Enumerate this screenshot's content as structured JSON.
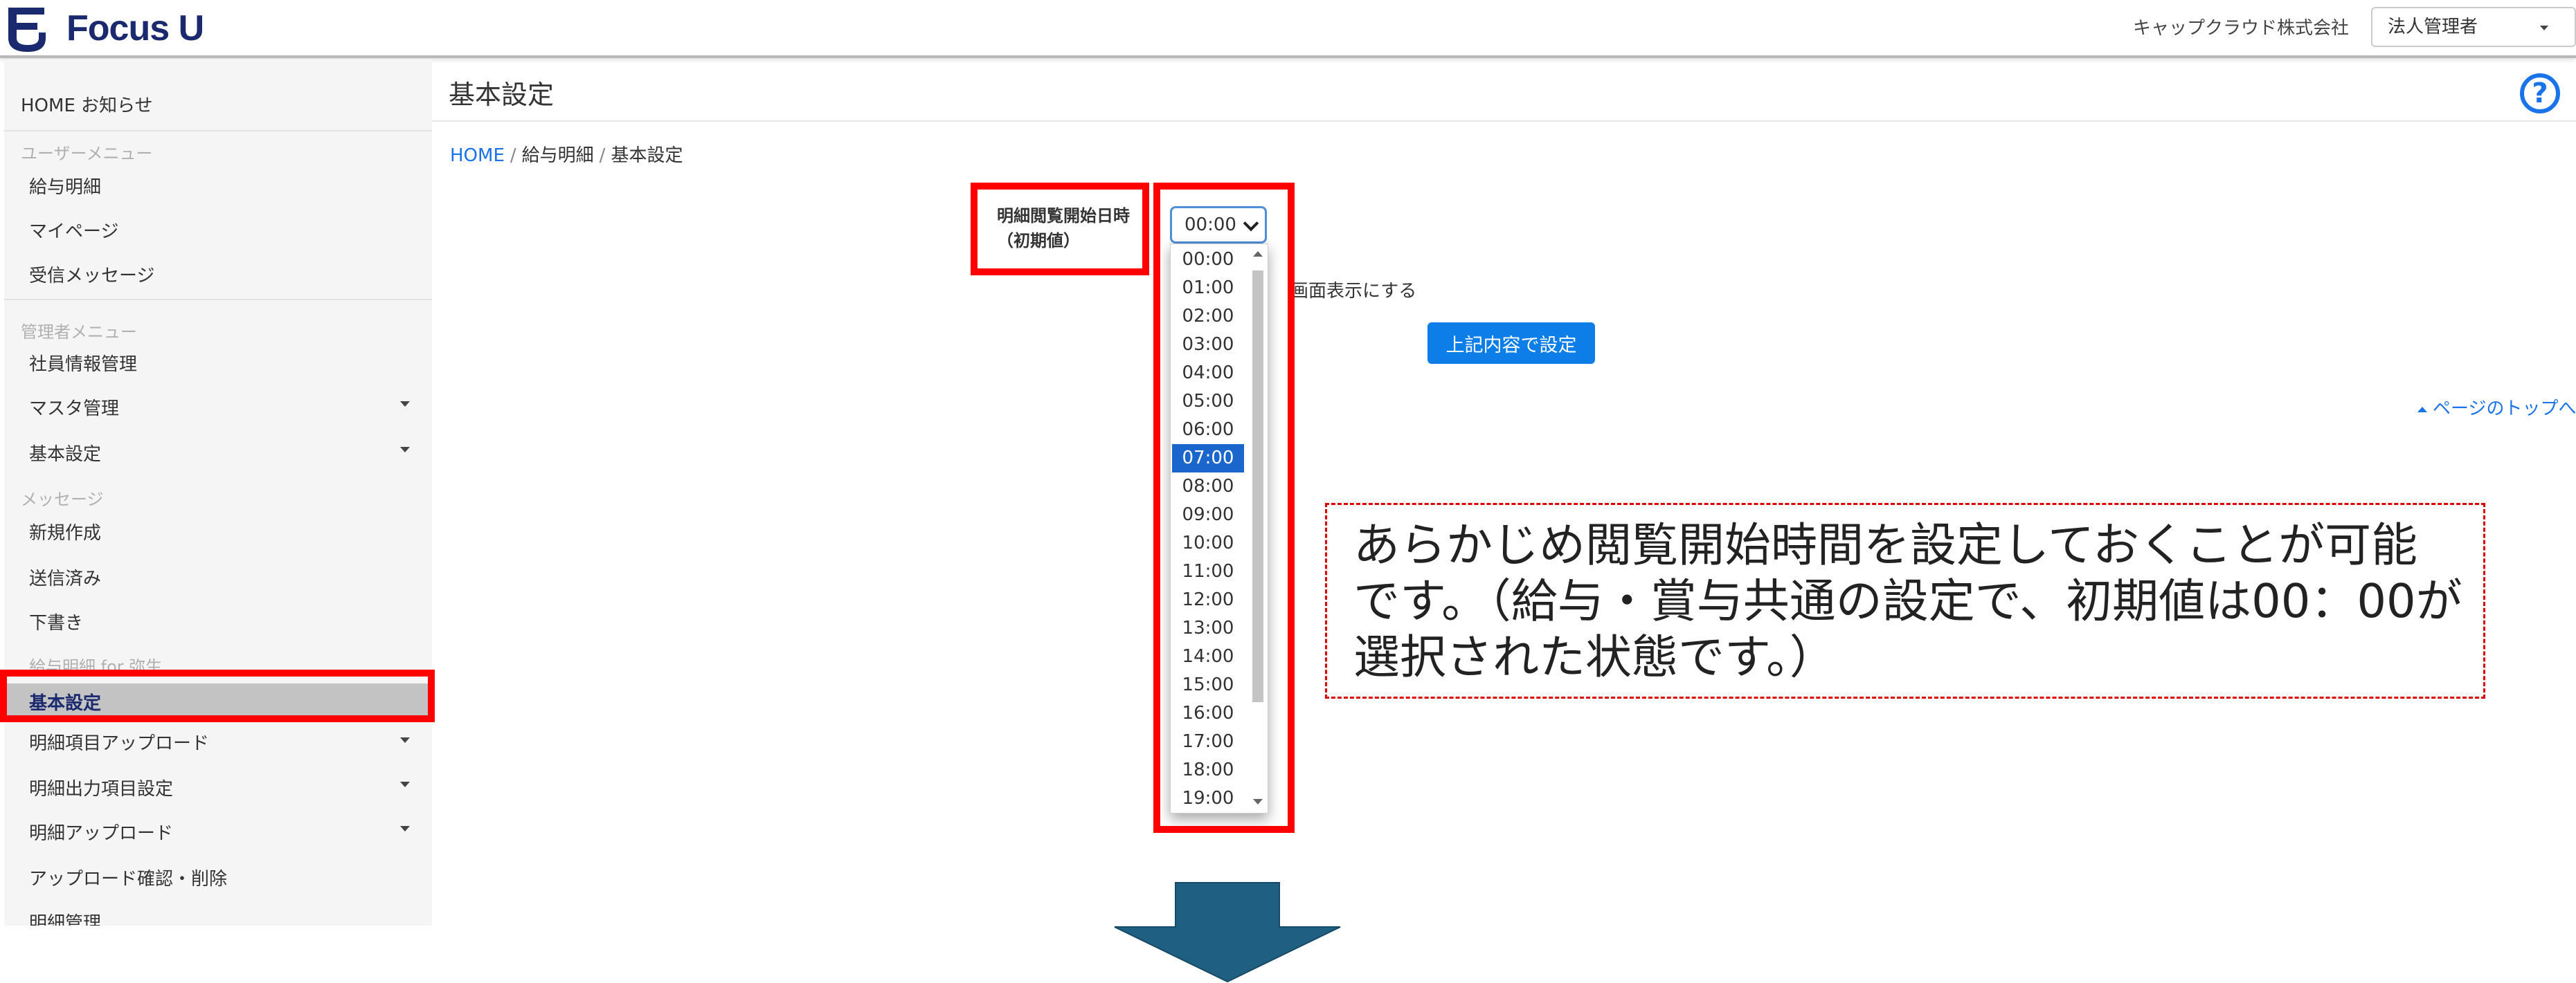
{
  "header": {
    "logo_text": "Focus U",
    "company": "キャップクラウド株式会社",
    "role": "法人管理者"
  },
  "sidebar": {
    "home": "HOME お知らせ",
    "user_menu_heading": "ユーザーメニュー",
    "user_items": [
      "給与明細",
      "マイページ",
      "受信メッセージ"
    ],
    "admin_menu_heading": "管理者メニュー",
    "admin_items": [
      "社員情報管理",
      "マスタ管理",
      "基本設定"
    ],
    "message_heading": "メッセージ",
    "message_items": [
      "新規作成",
      "送信済み",
      "下書き"
    ],
    "payslip_heading": "給与明細 for 弥生",
    "payslip_items": [
      "基本設定",
      "明細項目アップロード",
      "明細出力項目設定",
      "明細アップロード",
      "アップロード確認・削除",
      "明細管理"
    ],
    "active_item": "基本設定"
  },
  "main": {
    "title": "基本設定",
    "breadcrumb": [
      "HOME",
      "給与明細",
      "基本設定"
    ],
    "field_label_line1": "明細閲覧開始日時",
    "field_label_line2": "（初期値）",
    "selected_time": "00:00",
    "time_options": [
      "00:00",
      "01:00",
      "02:00",
      "03:00",
      "04:00",
      "05:00",
      "06:00",
      "07:00",
      "08:00",
      "09:00",
      "10:00",
      "11:00",
      "12:00",
      "13:00",
      "14:00",
      "15:00",
      "16:00",
      "17:00",
      "18:00",
      "19:00"
    ],
    "highlighted_option": "07:00",
    "checkbox_label_partial": "画面表示にする",
    "submit_label": "上記内容で設定",
    "page_top_link": "ページのトップへ"
  },
  "annotation": {
    "text": "あらかじめ閲覧開始時間を設定しておくことが可能です。（給与・賞与共通の設定で、初期値は00：00が選択された状態です。）"
  },
  "colors": {
    "accent": "#1a73e8",
    "brand_navy": "#1b2a6e",
    "highlight_red": "#ff0000",
    "arrow": "#1f5f82"
  }
}
